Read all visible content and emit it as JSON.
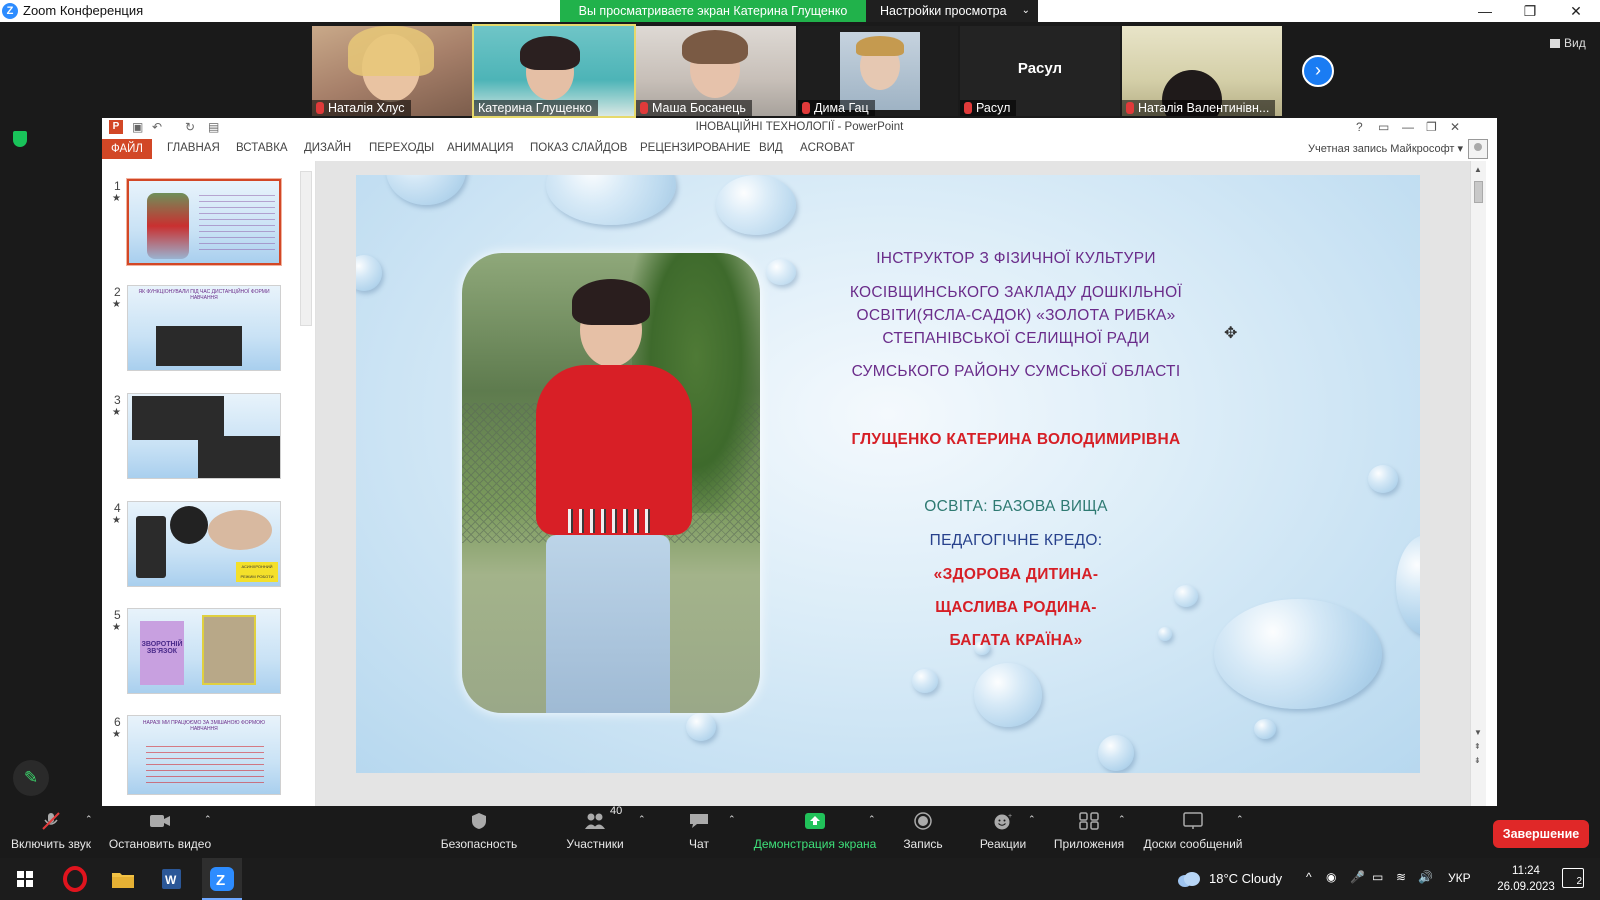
{
  "window": {
    "app_title": "Zoom Конференция",
    "share_banner": "Вы просматриваете экран Катерина Глущенко",
    "view_settings": "Настройки просмотра",
    "minimize": "—",
    "restore": "❐",
    "close": "✕"
  },
  "gallery": {
    "participants": [
      {
        "name": "Наталія Хлус"
      },
      {
        "name": "Катерина Глущенко"
      },
      {
        "name": "Маша Босанець"
      },
      {
        "name": "Дима Гац"
      },
      {
        "name": "Расул",
        "display": "Расул"
      },
      {
        "name": "Наталія Валентинівн..."
      }
    ],
    "next_arrow": "›",
    "view_label": "Вид"
  },
  "ppt": {
    "doc_title": "ІНОВАЦІЙНІ ТЕХНОЛОГІЇ - PowerPoint",
    "titlebar_controls": [
      "?",
      "▭",
      "—",
      "❐",
      "✕"
    ],
    "tabs": [
      "ФАЙЛ",
      "ГЛАВНАЯ",
      "ВСТАВКА",
      "ДИЗАЙН",
      "ПЕРЕХОДЫ",
      "АНИМАЦИЯ",
      "ПОКАЗ СЛАЙДОВ",
      "РЕЦЕНЗИРОВАНИЕ",
      "ВИД",
      "ACROBAT"
    ],
    "account": "Учетная запись Майкрософт",
    "thumbnails": [
      {
        "num": "1",
        "star": "★"
      },
      {
        "num": "2",
        "star": "★",
        "text": "ЯК ФУНКЦІОНУВАЛИ ПІД ЧАС ДИСТАНЦІЙНОЇ ФОРМИ НАВЧАННЯ"
      },
      {
        "num": "3",
        "star": "★"
      },
      {
        "num": "4",
        "star": "★",
        "text": "АСИНХРОННИЙ РЕЖИМ РОБОТИ"
      },
      {
        "num": "5",
        "star": "★",
        "text": "ЗВОРОТНІЙ ЗВ'ЯЗОК"
      },
      {
        "num": "6",
        "star": "★",
        "text": "НАРАЗІ МИ ПРАЦЮЄМО ЗА ЗМІШАНОЮ ФОРМОЮ НАВЧАННЯ"
      }
    ],
    "slide": {
      "line1": "ІНСТРУКТОР З ФІЗИЧНОЇ КУЛЬТУРИ",
      "line2": "КОСІВЩИНСЬКОГО ЗАКЛАДУ ДОШКІЛЬНОЇ",
      "line3": "ОСВІТИ(ЯСЛА-САДОК) «ЗОЛОТА РИБКА»",
      "line4": "СТЕПАНІВСЬКОЇ СЕЛИЩНОЇ РАДИ",
      "line5": "СУМСЬКОГО РАЙОНУ СУМСЬКОЇ ОБЛАСТІ",
      "name": "ГЛУЩЕНКО КАТЕРИНА ВОЛОДИМИРІВНА",
      "education": "ОСВІТА: БАЗОВА ВИЩА",
      "credo_label": "ПЕДАГОГІЧНЕ КРЕДО:",
      "credo1": "«ЗДОРОВА ДИТИНА-",
      "credo2": "ЩАСЛИВА РОДИНА-",
      "credo3": "БАГАТА КРАЇНА»"
    }
  },
  "toolbar": {
    "unmute": "Включить звук",
    "stop_video": "Остановить видео",
    "security": "Безопасность",
    "participants": "Участники",
    "participants_count": "40",
    "chat": "Чат",
    "share": "Демонстрация экрана",
    "record": "Запись",
    "reactions": "Реакции",
    "apps": "Приложения",
    "whiteboards": "Доски сообщений",
    "end": "Завершение"
  },
  "taskbar": {
    "weather": "18°C  Cloudy",
    "lang": "УКР",
    "time": "11:24",
    "date": "26.09.2023",
    "notifications": "2"
  },
  "colors": {
    "share_green": "#21b24b",
    "ppt_orange": "#d24726",
    "end_red": "#e02828",
    "slide_purple": "#6a2c8a",
    "slide_red": "#d61f26"
  }
}
